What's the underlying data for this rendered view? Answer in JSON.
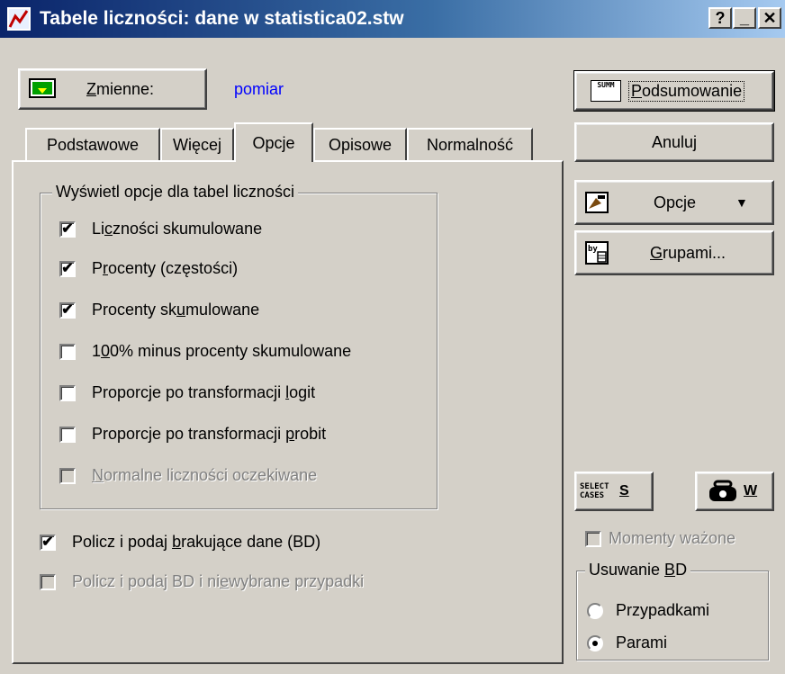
{
  "window": {
    "title": "Tabele liczności: dane w statistica02.stw"
  },
  "variables": {
    "button_label": "Zmienne:",
    "value": "pomiar"
  },
  "tabs": [
    "Podstawowe",
    "Więcej",
    "Opcje",
    "Opisowe",
    "Normalność"
  ],
  "group": {
    "legend": "Wyświetl opcje dla tabel liczności",
    "options": [
      {
        "label": "Liczności skumulowane",
        "checked": true
      },
      {
        "label": "Procenty (częstości)",
        "checked": true
      },
      {
        "label": "Procenty skumulowane",
        "checked": true
      },
      {
        "label": "100% minus procenty skumulowane",
        "checked": false
      },
      {
        "label": "Proporcje po transformacji logit",
        "checked": false
      },
      {
        "label": "Proporcje po transformacji probit",
        "checked": false
      },
      {
        "label": "Normalne liczności oczekiwane",
        "checked": false,
        "disabled": true
      }
    ]
  },
  "missing": {
    "count_label": "Policz i podaj brakujące dane (BD)",
    "count_unselected_label": "Policz i podaj BD i niewybrane przypadki"
  },
  "buttons": {
    "summary": "Podsumowanie",
    "summary_icon_text": "SUMM",
    "cancel": "Anuluj",
    "options": "Opcje",
    "by_group": "Grupami...",
    "select_cases_icon": "SELECT CASES",
    "select_cases": "S",
    "weights": "W"
  },
  "weighted_moments": "Momenty ważone",
  "md_deletion": {
    "legend": "Usuwanie BD",
    "options": [
      "Przypadkami",
      "Parami"
    ],
    "selected": "Parami"
  }
}
